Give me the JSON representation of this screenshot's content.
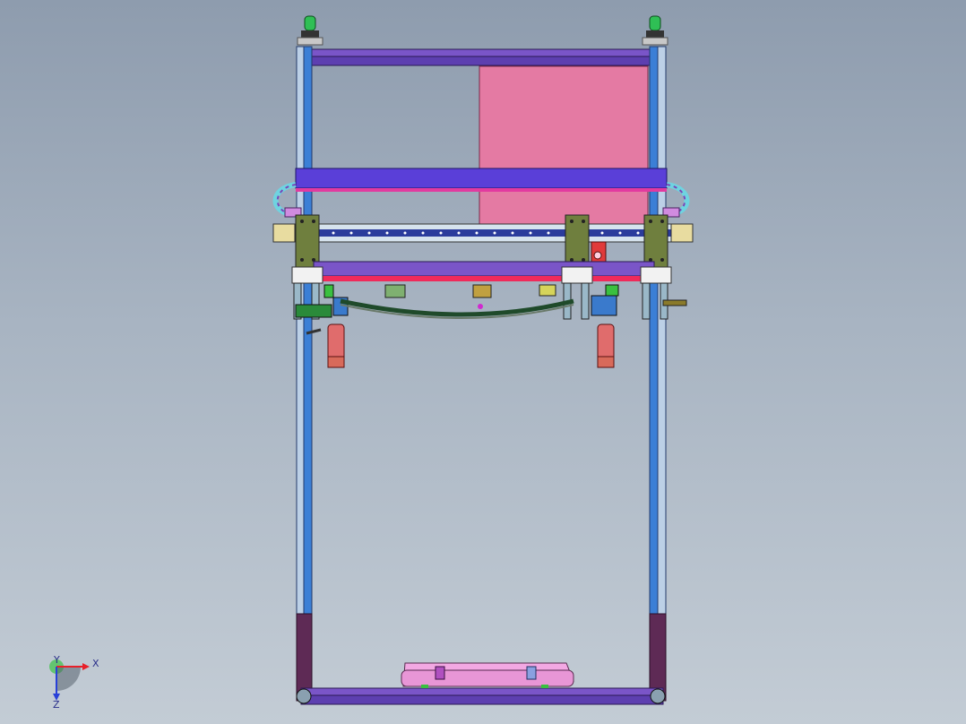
{
  "view": {
    "type": "cad-3d-viewport",
    "background_top": "#8e9cae",
    "background_bottom": "#c3ccd5"
  },
  "triad": {
    "x_label": "X",
    "y_label": "Y",
    "z_label": "Z",
    "x_color": "#e8202a",
    "y_color": "#27c12f",
    "z_color": "#2840d8"
  },
  "palette": {
    "frame_blue": "#3b7fd6",
    "frame_purple": "#6b3fa8",
    "beam_violet": "#5a3fd8",
    "panel_pink": "#e47aa3",
    "block_olive": "#6f7f3e",
    "cylinder_salmon": "#e06c6c",
    "tray_pink": "#f3a8e3",
    "leveler_green": "#2fbf55"
  }
}
